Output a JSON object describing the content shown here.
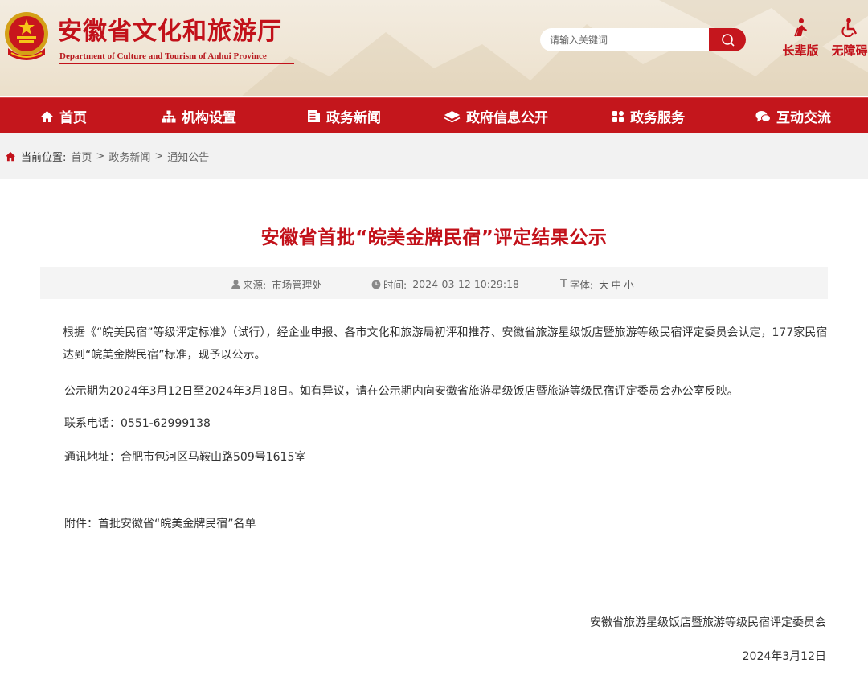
{
  "header": {
    "title": "安徽省文化和旅游厅",
    "subtitle": "Department of Culture and Tourism of Anhui Province",
    "search_placeholder": "请输入关键词",
    "tools": [
      {
        "label": "长辈版",
        "icon": "elder-mode-icon"
      },
      {
        "label": "无障碍",
        "icon": "accessibility-icon"
      }
    ]
  },
  "nav": {
    "items": [
      {
        "label": "首页",
        "icon": "home-icon"
      },
      {
        "label": "机构设置",
        "icon": "org-chart-icon"
      },
      {
        "label": "政务新闻",
        "icon": "news-icon"
      },
      {
        "label": "政府信息公开",
        "icon": "layers-icon"
      },
      {
        "label": "政务服务",
        "icon": "grid-icon"
      },
      {
        "label": "互动交流",
        "icon": "chat-icon"
      }
    ]
  },
  "breadcrumb": {
    "label": "当前位置:",
    "items": [
      "首页",
      "政务新闻",
      "通知公告"
    ],
    "separator": ">"
  },
  "article": {
    "title": "安徽省首批“皖美金牌民宿”评定结果公示",
    "meta": {
      "source_label": "来源:",
      "source": "市场管理处",
      "time_label": "时间:",
      "time": "2024-03-12 10:29:18",
      "font_label": "字体:",
      "font_sizes": [
        "大",
        "中",
        "小"
      ]
    },
    "paragraphs": [
      "根据《“皖美民宿”等级评定标准》（试行），经企业申报、各市文化和旅游局初评和推荐、安徽省旅游星级饭店暨旅游等级民宿评定委员会认定，177家民宿达到“皖美金牌民宿”标准，现予以公示。",
      "公示期为2024年3月12日至2024年3月18日。如有异议，请在公示期内向安徽省旅游星级饭店暨旅游等级民宿评定委员会办公室反映。",
      "联系电话：0551-62999138",
      "通讯地址：合肥市包河区马鞍山路509号1615室",
      "附件：首批安徽省“皖美金牌民宿”名单"
    ],
    "signature": "安徽省旅游星级饭店暨旅游等级民宿评定委员会",
    "date": "2024年3月12日"
  },
  "colors": {
    "brand_red": "#c4161c",
    "title_red": "#c2111a",
    "meta_bg": "#f4f4f4",
    "crumb_bg": "#f2f2f2"
  }
}
